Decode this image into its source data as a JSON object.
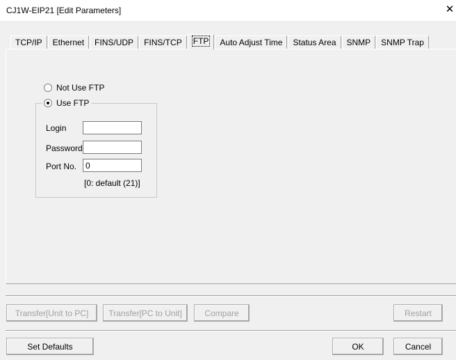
{
  "window": {
    "title": "CJ1W-EIP21 [Edit Parameters]",
    "close_glyph": "✕"
  },
  "tabs": [
    {
      "label": "TCP/IP"
    },
    {
      "label": "Ethernet"
    },
    {
      "label": "FINS/UDP"
    },
    {
      "label": "FINS/TCP"
    },
    {
      "label": "FTP"
    },
    {
      "label": "Auto Adjust Time"
    },
    {
      "label": "Status Area"
    },
    {
      "label": "SNMP"
    },
    {
      "label": "SNMP Trap"
    }
  ],
  "active_tab": "FTP",
  "ftp": {
    "not_use_label": "Not Use FTP",
    "use_label": "Use FTP",
    "selected": "Use FTP",
    "login_label": "Login",
    "login_value": "",
    "password_label": "Password",
    "password_value": "",
    "port_label": "Port No.",
    "port_value": "0",
    "port_hint": "[0: default (21)]"
  },
  "buttons": {
    "transfer_unit_to_pc": "Transfer[Unit to PC]",
    "transfer_pc_to_unit": "Transfer[PC to Unit]",
    "compare": "Compare",
    "restart": "Restart",
    "set_defaults": "Set Defaults",
    "ok": "OK",
    "cancel": "Cancel"
  }
}
